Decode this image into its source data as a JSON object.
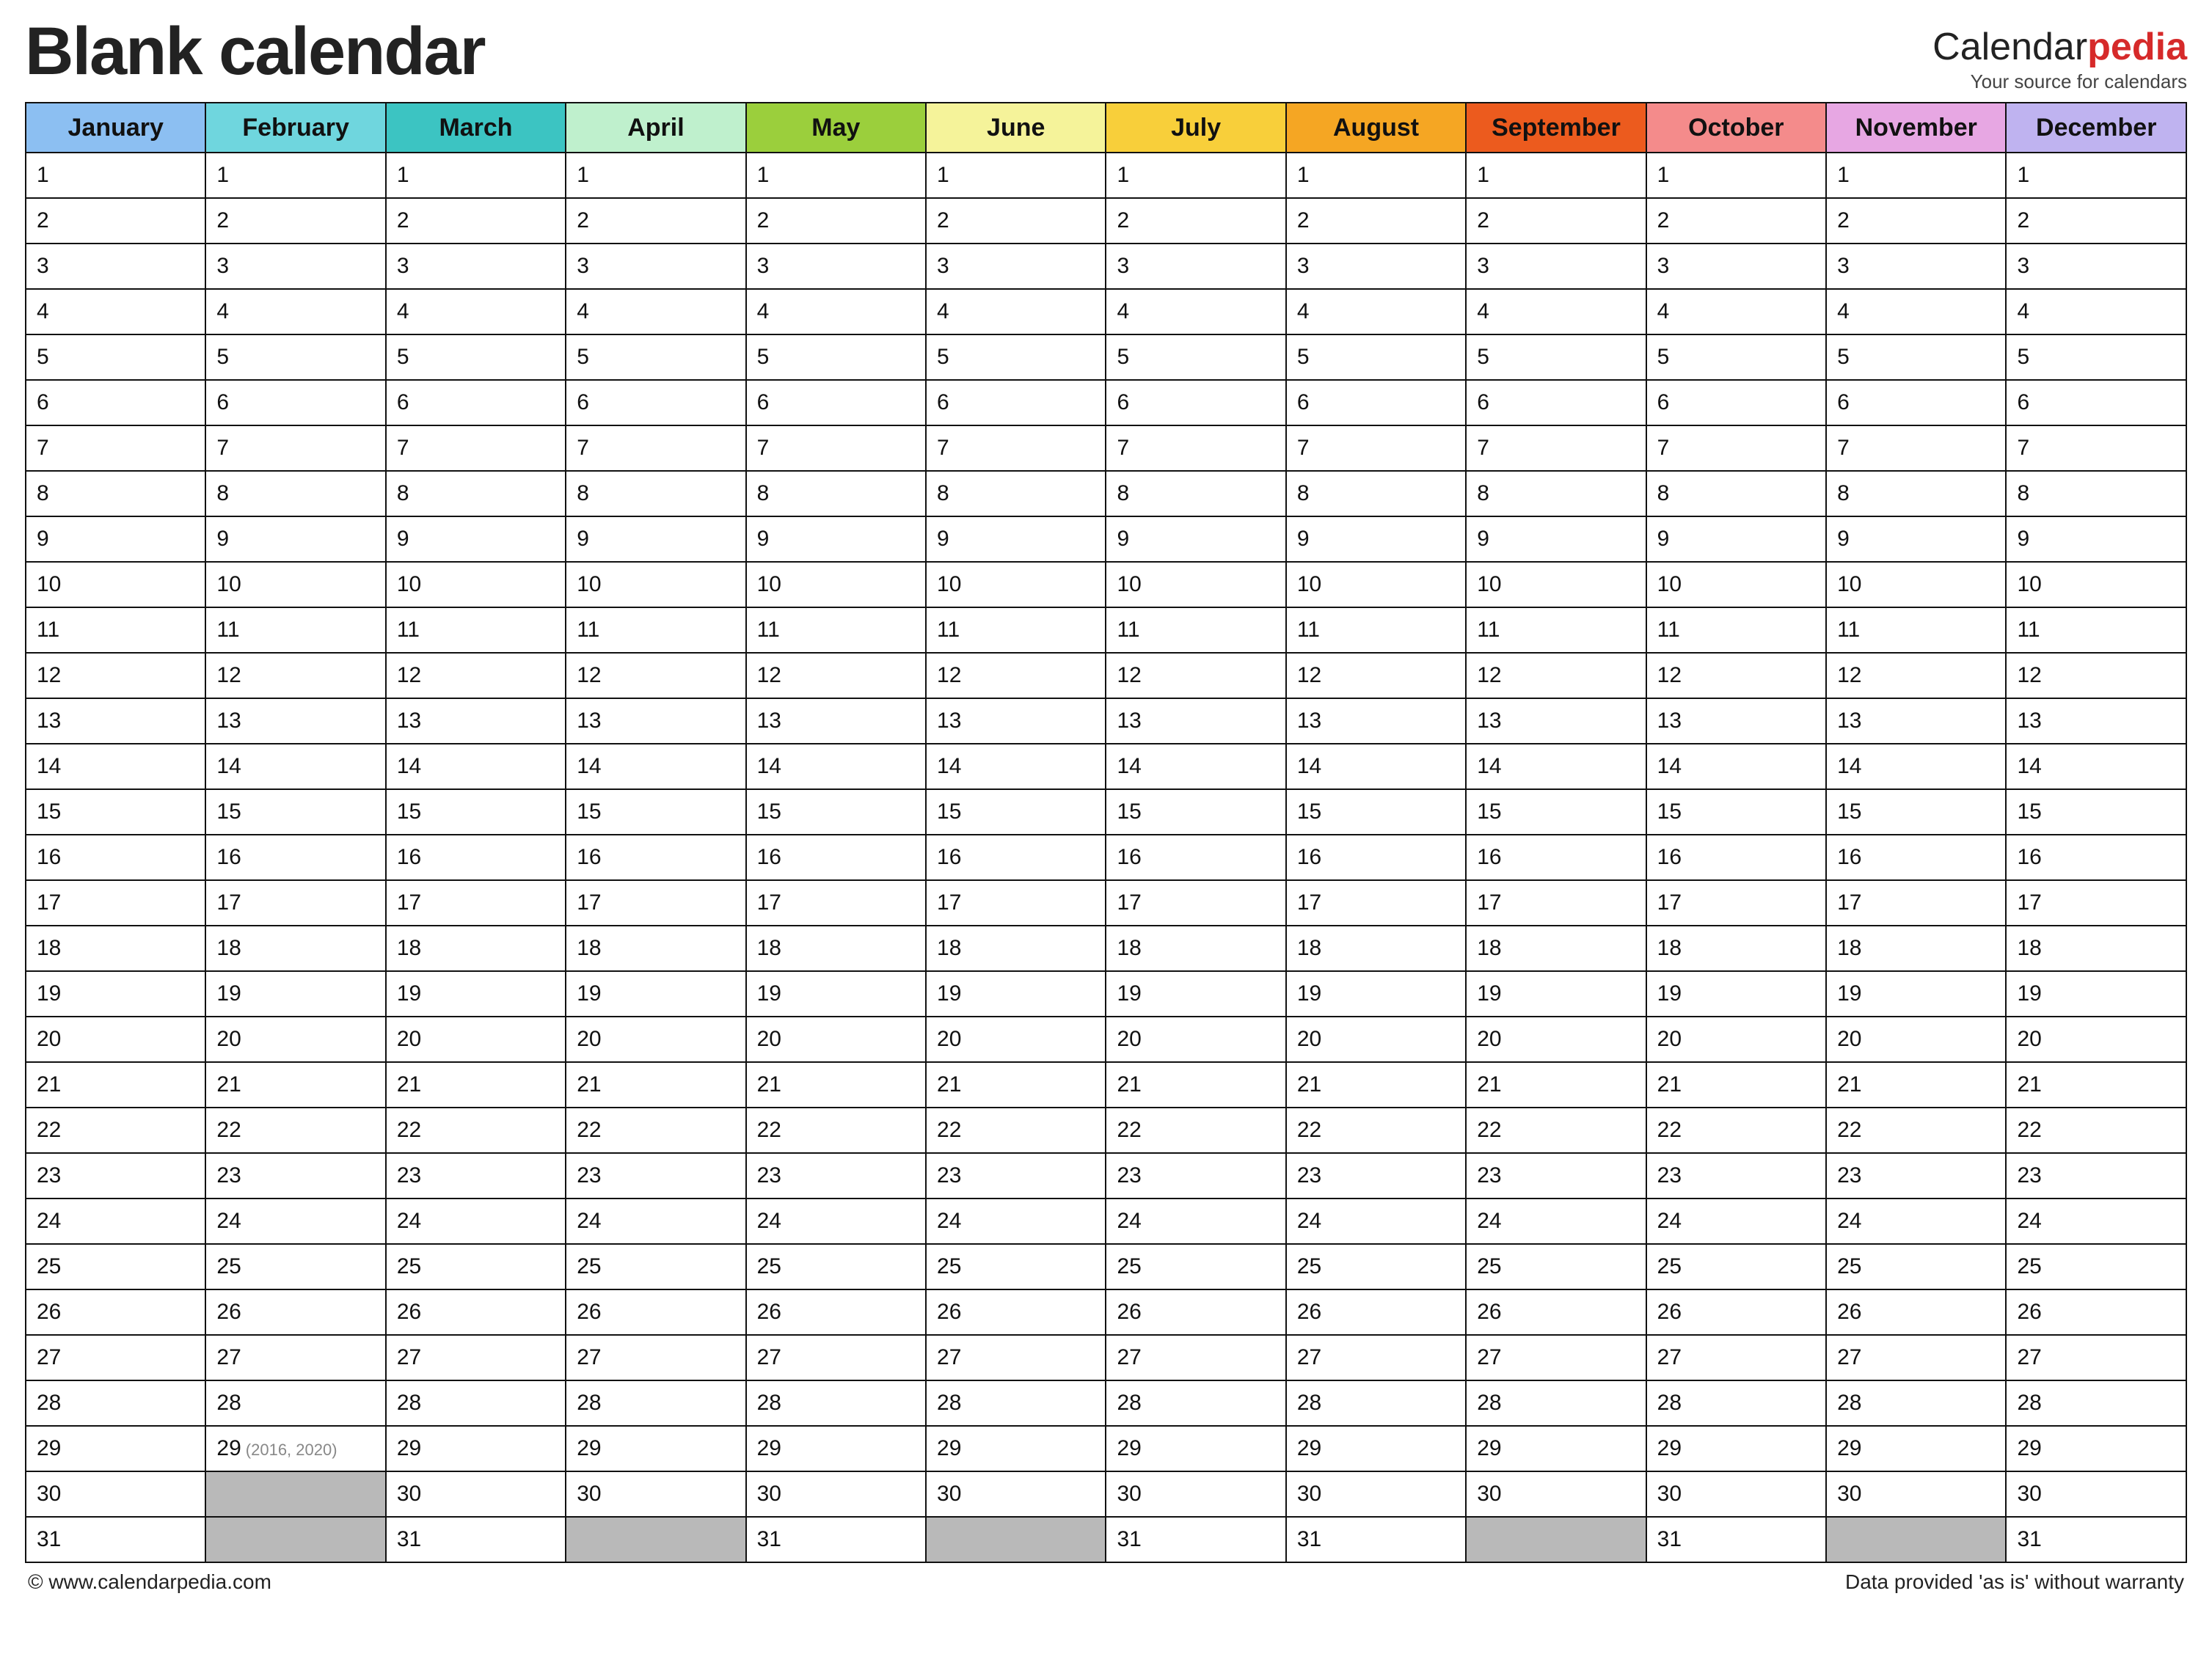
{
  "header": {
    "title": "Blank calendar",
    "brand_prefix": "Calendar",
    "brand_accent": "pedia",
    "brand_tagline": "Your source for calendars"
  },
  "footer": {
    "copyright": "© www.calendarpedia.com",
    "disclaimer": "Data provided 'as is' without warranty"
  },
  "months": [
    {
      "name": "January",
      "color": "#8cbff2",
      "days": 31
    },
    {
      "name": "February",
      "color": "#6fd6de",
      "days": 29,
      "day29_note": "(2016, 2020)",
      "day29_grey": true,
      "no30": true,
      "no31": true
    },
    {
      "name": "March",
      "color": "#3cc4c2",
      "days": 31
    },
    {
      "name": "April",
      "color": "#bff0cd",
      "days": 30,
      "no31": true
    },
    {
      "name": "May",
      "color": "#9bcf3c",
      "days": 31
    },
    {
      "name": "June",
      "color": "#f5f39a",
      "days": 30,
      "no31": true
    },
    {
      "name": "July",
      "color": "#f8cf3a",
      "days": 31
    },
    {
      "name": "August",
      "color": "#f5a623",
      "days": 31
    },
    {
      "name": "September",
      "color": "#ec5b1e",
      "days": 30,
      "no31": true
    },
    {
      "name": "October",
      "color": "#f48b8b",
      "days": 31
    },
    {
      "name": "November",
      "color": "#e7a7e3",
      "days": 30,
      "no31": true
    },
    {
      "name": "December",
      "color": "#bfb3f0",
      "days": 31
    }
  ],
  "rows": 31
}
